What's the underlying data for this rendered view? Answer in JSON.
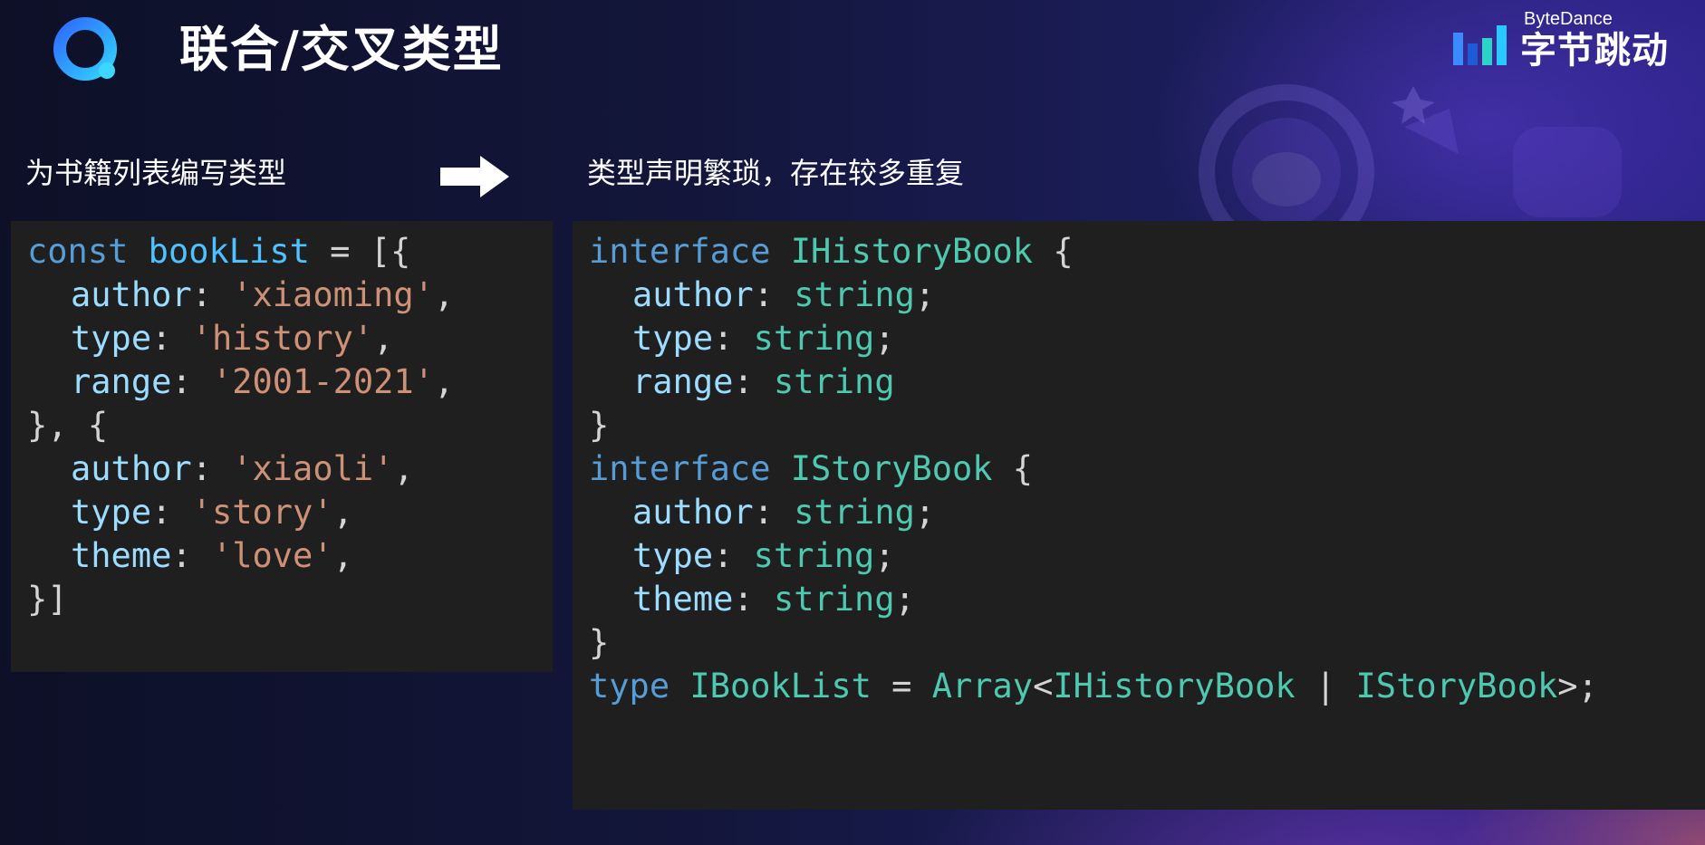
{
  "header": {
    "title": "联合/交叉类型",
    "logo_icon": "app-logo-icon",
    "brand": {
      "name_en": "ByteDance",
      "name_cn": "字节跳动",
      "bar_colors": [
        "#3a8bff",
        "#2ad4c8",
        "#1e5bd6",
        "#27c9ff"
      ]
    }
  },
  "captions": {
    "left": "为书籍列表编写类型",
    "arrow_icon": "right-arrow-icon",
    "right": "类型声明繁琐，存在较多重复"
  },
  "left_code": {
    "lines": [
      {
        "indent": false,
        "tokens": [
          {
            "t": "const",
            "c": "kw"
          },
          {
            "t": " ",
            "c": "punc"
          },
          {
            "t": "bookList",
            "c": "var"
          },
          {
            "t": " = [{",
            "c": "punc"
          }
        ]
      },
      {
        "indent": true,
        "tokens": [
          {
            "t": "author",
            "c": "prop"
          },
          {
            "t": ": ",
            "c": "punc"
          },
          {
            "t": "'xiaoming'",
            "c": "str"
          },
          {
            "t": ",",
            "c": "punc"
          }
        ]
      },
      {
        "indent": true,
        "tokens": [
          {
            "t": "type",
            "c": "prop"
          },
          {
            "t": ": ",
            "c": "punc"
          },
          {
            "t": "'history'",
            "c": "str"
          },
          {
            "t": ",",
            "c": "punc"
          }
        ]
      },
      {
        "indent": true,
        "tokens": [
          {
            "t": "range",
            "c": "prop"
          },
          {
            "t": ": ",
            "c": "punc"
          },
          {
            "t": "'2001-2021'",
            "c": "str"
          },
          {
            "t": ",",
            "c": "punc"
          }
        ]
      },
      {
        "indent": false,
        "tokens": [
          {
            "t": "}, {",
            "c": "punc"
          }
        ]
      },
      {
        "indent": true,
        "tokens": [
          {
            "t": "author",
            "c": "prop"
          },
          {
            "t": ": ",
            "c": "punc"
          },
          {
            "t": "'xiaoli'",
            "c": "str"
          },
          {
            "t": ",",
            "c": "punc"
          }
        ]
      },
      {
        "indent": true,
        "tokens": [
          {
            "t": "type",
            "c": "prop"
          },
          {
            "t": ": ",
            "c": "punc"
          },
          {
            "t": "'story'",
            "c": "str"
          },
          {
            "t": ",",
            "c": "punc"
          }
        ]
      },
      {
        "indent": true,
        "tokens": [
          {
            "t": "theme",
            "c": "prop"
          },
          {
            "t": ": ",
            "c": "punc"
          },
          {
            "t": "'love'",
            "c": "str"
          },
          {
            "t": ",",
            "c": "punc"
          }
        ]
      },
      {
        "indent": false,
        "tokens": [
          {
            "t": "}]",
            "c": "punc"
          }
        ]
      }
    ]
  },
  "right_code": {
    "lines": [
      {
        "indent": false,
        "tokens": [
          {
            "t": "interface",
            "c": "kw"
          },
          {
            "t": " ",
            "c": "punc"
          },
          {
            "t": "IHistoryBook",
            "c": "type"
          },
          {
            "t": " {",
            "c": "punc"
          }
        ]
      },
      {
        "indent": true,
        "tokens": [
          {
            "t": "author",
            "c": "prop"
          },
          {
            "t": ": ",
            "c": "punc"
          },
          {
            "t": "string",
            "c": "type"
          },
          {
            "t": ";",
            "c": "punc"
          }
        ]
      },
      {
        "indent": true,
        "tokens": [
          {
            "t": "type",
            "c": "prop"
          },
          {
            "t": ": ",
            "c": "punc"
          },
          {
            "t": "string",
            "c": "type"
          },
          {
            "t": ";",
            "c": "punc"
          }
        ]
      },
      {
        "indent": true,
        "tokens": [
          {
            "t": "range",
            "c": "prop"
          },
          {
            "t": ": ",
            "c": "punc"
          },
          {
            "t": "string",
            "c": "type"
          }
        ]
      },
      {
        "indent": false,
        "tokens": [
          {
            "t": "}",
            "c": "punc"
          }
        ]
      },
      {
        "indent": false,
        "tokens": [
          {
            "t": "interface",
            "c": "kw"
          },
          {
            "t": " ",
            "c": "punc"
          },
          {
            "t": "IStoryBook",
            "c": "type"
          },
          {
            "t": " {",
            "c": "punc"
          }
        ]
      },
      {
        "indent": true,
        "tokens": [
          {
            "t": "author",
            "c": "prop"
          },
          {
            "t": ": ",
            "c": "punc"
          },
          {
            "t": "string",
            "c": "type"
          },
          {
            "t": ";",
            "c": "punc"
          }
        ]
      },
      {
        "indent": true,
        "tokens": [
          {
            "t": "type",
            "c": "prop"
          },
          {
            "t": ": ",
            "c": "punc"
          },
          {
            "t": "string",
            "c": "type"
          },
          {
            "t": ";",
            "c": "punc"
          }
        ]
      },
      {
        "indent": true,
        "tokens": [
          {
            "t": "theme",
            "c": "prop"
          },
          {
            "t": ": ",
            "c": "punc"
          },
          {
            "t": "string",
            "c": "type"
          },
          {
            "t": ";",
            "c": "punc"
          }
        ]
      },
      {
        "indent": false,
        "tokens": [
          {
            "t": "}",
            "c": "punc"
          }
        ]
      },
      {
        "indent": false,
        "tokens": [
          {
            "t": "type",
            "c": "kw"
          },
          {
            "t": " ",
            "c": "punc"
          },
          {
            "t": "IBookList",
            "c": "type"
          },
          {
            "t": " = ",
            "c": "punc"
          },
          {
            "t": "Array",
            "c": "type"
          },
          {
            "t": "<",
            "c": "punc"
          },
          {
            "t": "IHistoryBook",
            "c": "type"
          },
          {
            "t": " | ",
            "c": "punc"
          },
          {
            "t": "IStoryBook",
            "c": "type"
          },
          {
            "t": ">;",
            "c": "punc"
          }
        ]
      }
    ]
  },
  "colors": {
    "code_bg": "#1f1f1f",
    "keyword": "#569cd6",
    "variable": "#4fc1ff",
    "property": "#9cdcfe",
    "string": "#ce9178",
    "type": "#4ec9b0",
    "punctuation": "#d4d4d4"
  }
}
